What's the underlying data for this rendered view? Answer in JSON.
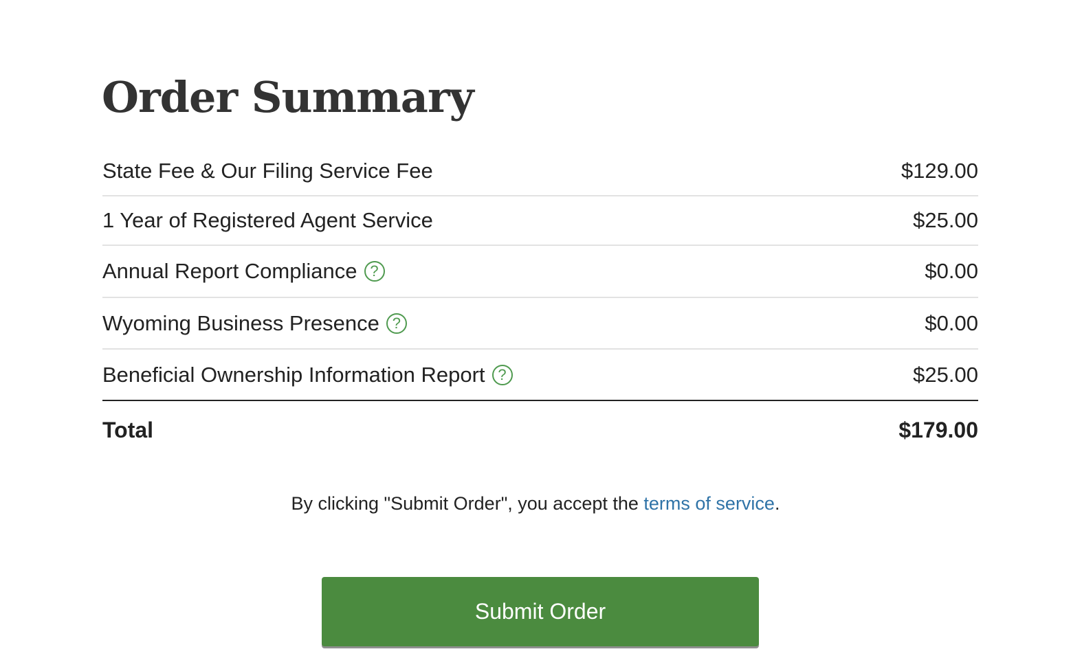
{
  "page": {
    "title": "Order Summary"
  },
  "summary": {
    "items": [
      {
        "label": "State Fee & Our Filing Service Fee",
        "amount": "$129.00",
        "help": false
      },
      {
        "label": "1 Year of Registered Agent Service",
        "amount": "$25.00",
        "help": false
      },
      {
        "label": "Annual Report Compliance",
        "amount": "$0.00",
        "help": true,
        "help_icon": "?"
      },
      {
        "label": "Wyoming Business Presence",
        "amount": "$0.00",
        "help": true,
        "help_icon": "?"
      },
      {
        "label": "Beneficial Ownership Information Report",
        "amount": "$25.00",
        "help": true,
        "help_icon": "?"
      }
    ],
    "total_label": "Total",
    "total_amount": "$179.00"
  },
  "terms": {
    "prefix": "By clicking \"Submit Order\", you accept the ",
    "link_text": "terms of service",
    "suffix": "."
  },
  "actions": {
    "submit_label": "Submit Order"
  },
  "colors": {
    "accent_green": "#4b8b3f",
    "help_icon_green": "#4f9a4f",
    "link_blue": "#2f73a7",
    "text": "#222222"
  }
}
